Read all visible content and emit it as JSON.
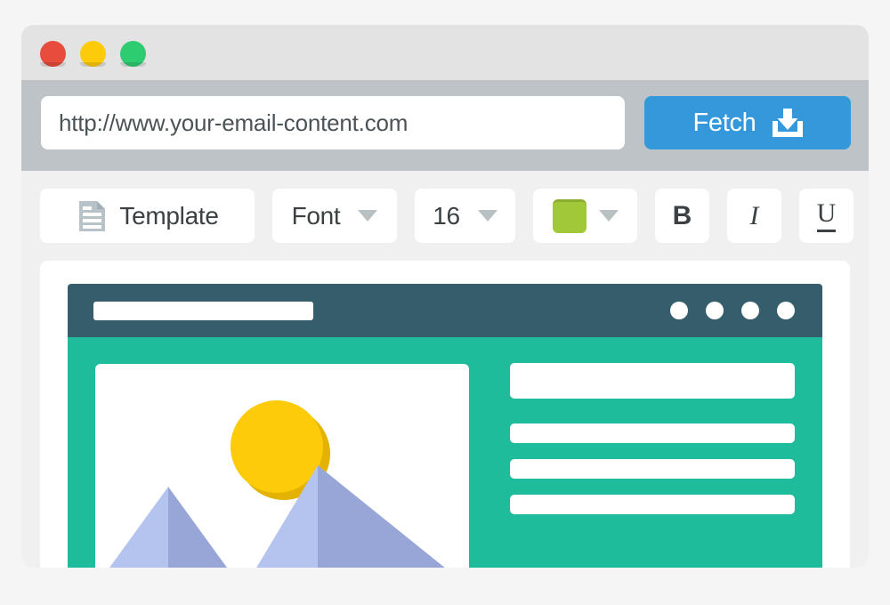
{
  "window": {
    "traffic_lights": [
      {
        "name": "close",
        "color": "#e74c3c"
      },
      {
        "name": "minimize",
        "color": "#fdcb0a"
      },
      {
        "name": "maximize",
        "color": "#2ecc71"
      }
    ]
  },
  "address_bar": {
    "url_value": "http://www.your-email-content.com",
    "url_placeholder": "http://www.your-email-content.com",
    "fetch_label": "Fetch",
    "fetch_icon": "download-icon",
    "fetch_color": "#3498db"
  },
  "toolbar": {
    "template_label": "Template",
    "template_icon": "document-icon",
    "font_label": "Font",
    "font_size_label": "16",
    "color_value": "#a0c838",
    "bold_label": "B",
    "italic_label": "I",
    "underline_label": "U",
    "caret_icon": "chevron-down-icon"
  },
  "preview": {
    "header_color": "#365d6b",
    "body_color": "#1ebc9b",
    "nav_dots": 4,
    "logo_placeholder": "",
    "text_lines": 3,
    "image": {
      "sun_color": "#fdcb0a",
      "sun_shadow_color": "#e3b203",
      "mountain_light_color": "#b4c4ef",
      "mountain_dark_color": "#97a6d6"
    }
  }
}
